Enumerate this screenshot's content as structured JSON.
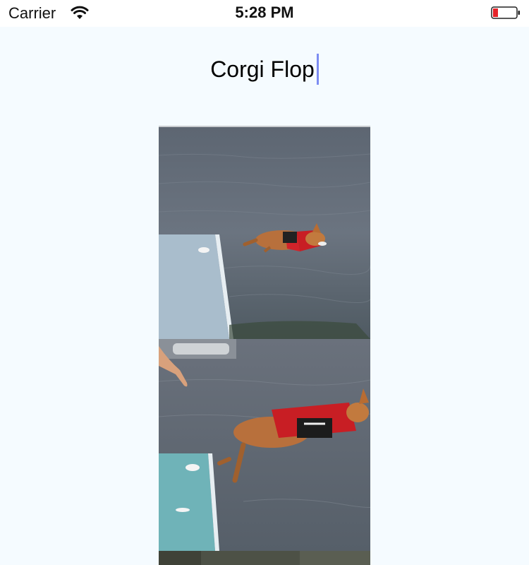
{
  "status_bar": {
    "carrier": "Carrier",
    "time": "5:28 PM",
    "wifi_icon": "wifi-icon",
    "battery_icon": "battery-low-icon",
    "battery_color": "#e5242a"
  },
  "editor": {
    "title_value": "Corgi Flop",
    "caret_color": "#7d8df2"
  },
  "gif": {
    "frames": [
      {
        "description_icon": "corgi-jump-frame-1"
      },
      {
        "description_icon": "corgi-jump-frame-2"
      },
      {
        "description_icon": "corgi-jump-frame-3"
      }
    ]
  },
  "colors": {
    "background": "#f5fbff",
    "water": "#5a6470",
    "dock": "#a9bdcc"
  }
}
